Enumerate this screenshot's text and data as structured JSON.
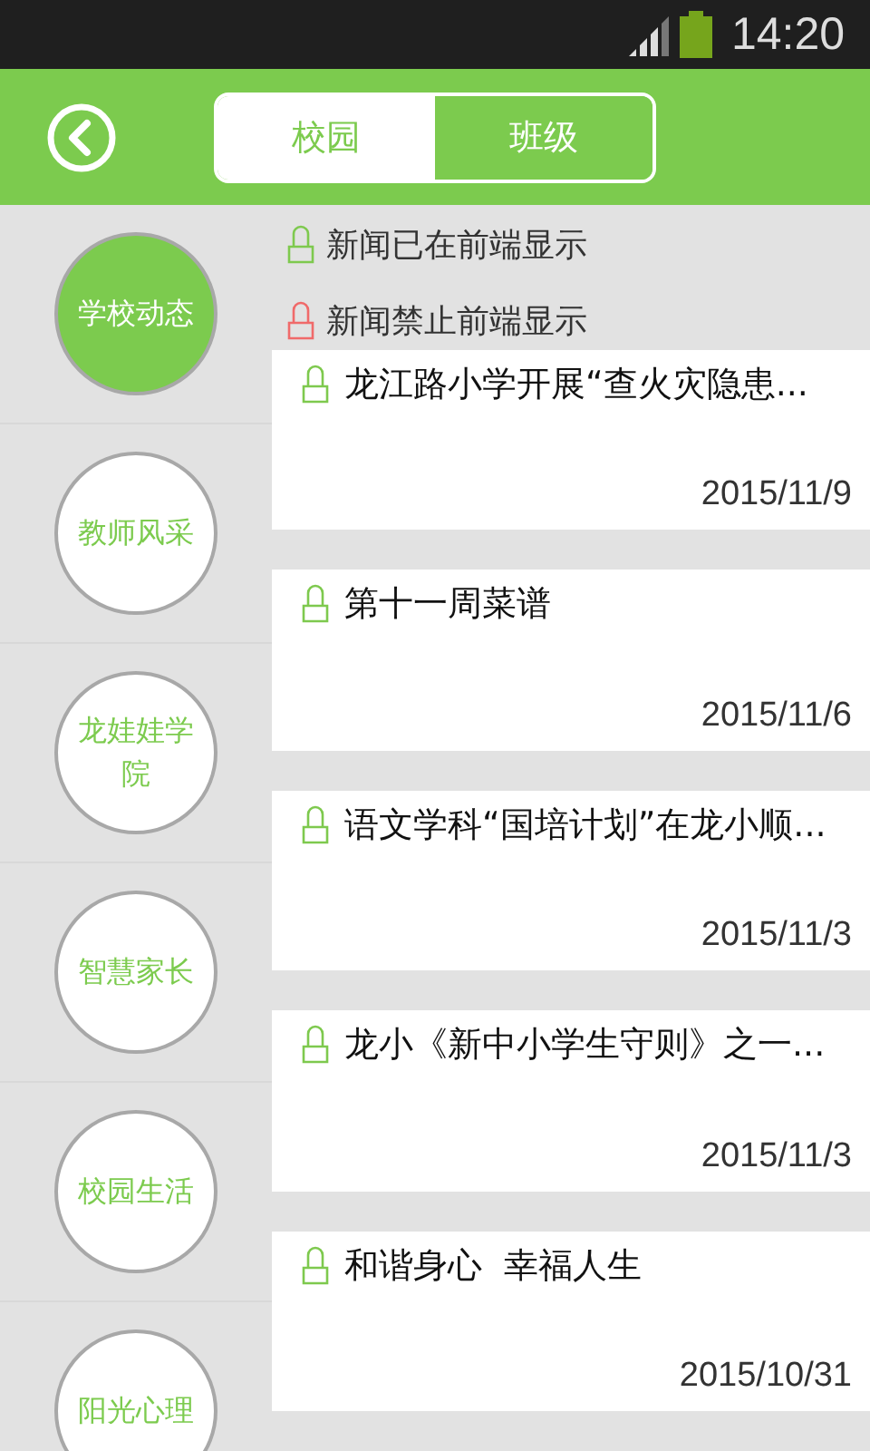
{
  "status_bar": {
    "time": "14:20"
  },
  "tabs": [
    {
      "label": "校园",
      "selected": false
    },
    {
      "label": "班级",
      "selected": true
    }
  ],
  "sidebar": {
    "items": [
      {
        "label": "学校动态",
        "selected": true
      },
      {
        "label": "教师风采",
        "selected": false
      },
      {
        "label": "龙娃娃学院",
        "selected": false
      },
      {
        "label": "智慧家长",
        "selected": false
      },
      {
        "label": "校园生活",
        "selected": false
      },
      {
        "label": "阳光心理",
        "selected": false
      }
    ]
  },
  "legend": [
    {
      "label": "新闻已在前端显示",
      "color": "#7ec94e"
    },
    {
      "label": "新闻禁止前端显示",
      "color": "#f06a6a"
    }
  ],
  "news": [
    {
      "title": "龙江路小学开展“查火灾隐患...",
      "date": "2015/11/9",
      "color": "#7ec94e"
    },
    {
      "title": "第十一周菜谱",
      "date": "2015/11/6",
      "color": "#7ec94e"
    },
    {
      "title": "语文学科“国培计划”在龙小顺...",
      "date": "2015/11/3",
      "color": "#7ec94e"
    },
    {
      "title": "龙小《新中小学生守则》之一...",
      "date": "2015/11/3",
      "color": "#7ec94e"
    },
    {
      "title": "和谐身心  幸福人生",
      "date": "2015/10/31",
      "color": "#7ec94e"
    }
  ]
}
